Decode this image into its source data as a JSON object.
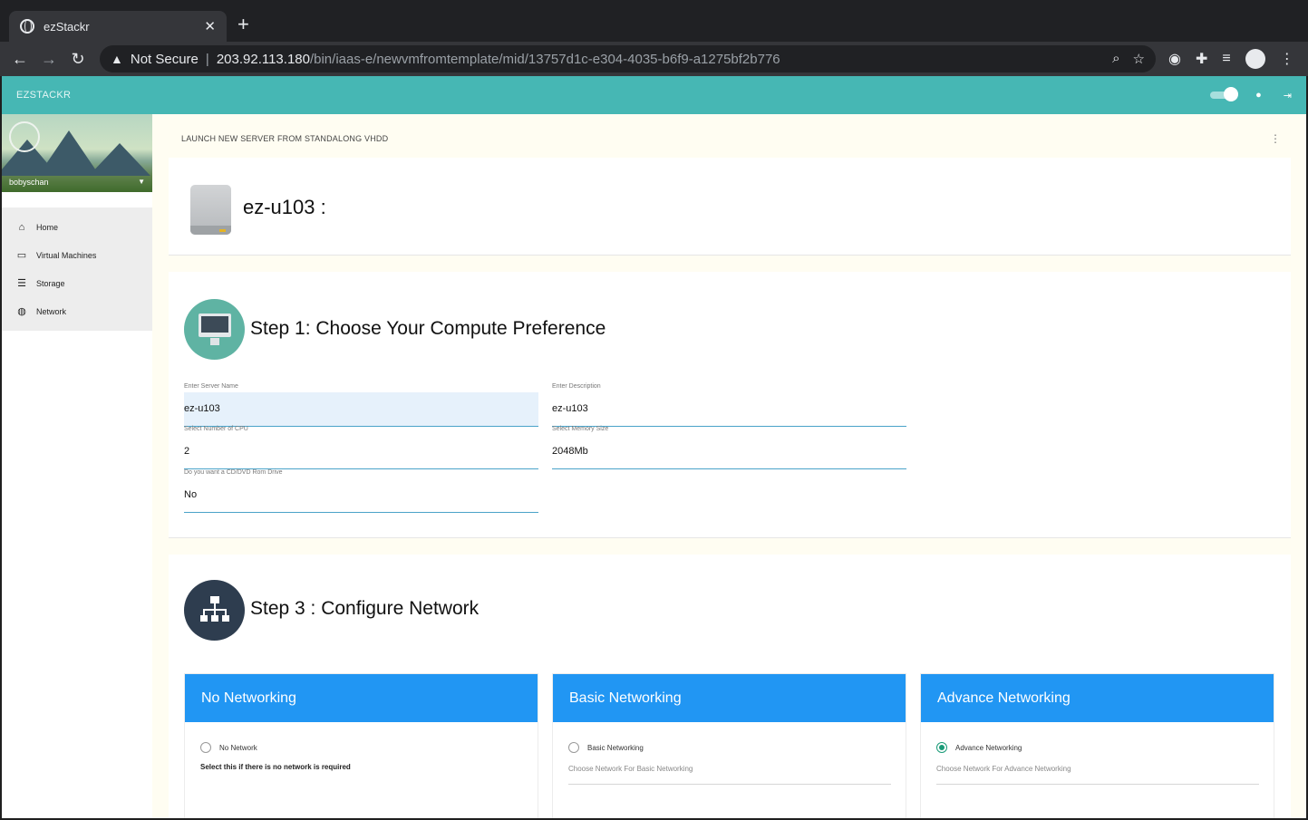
{
  "browser": {
    "tab_title": "ezStackr",
    "tab_close": "✕",
    "new_tab": "+",
    "security_label": "Not Secure",
    "url_host": "203.92.113.180",
    "url_path": "/bin/iaas-e/newvmfromtemplate/mid/13757d1c-e304-4035-b6f9-a1275bf2b776"
  },
  "app": {
    "brand": "EZSTACKR",
    "username": "bobyschan",
    "page_title": "LAUNCH NEW SERVER FROM STANDALONG VHDD",
    "vm_title": "ez-u103 :"
  },
  "sidebar": {
    "items": [
      {
        "label": "Home",
        "icon": "home-icon"
      },
      {
        "label": "Virtual Machines",
        "icon": "devices-icon"
      },
      {
        "label": "Storage",
        "icon": "storage-list-icon"
      },
      {
        "label": "Network",
        "icon": "globe-icon"
      }
    ]
  },
  "step1": {
    "title": "Step 1: Choose Your Compute Preference",
    "server_name_label": "Enter Server Name",
    "server_name_value": "ez-u103",
    "description_label": "Enter Description",
    "description_value": "ez-u103",
    "cpu_label": "Select Number of CPU",
    "cpu_value": "2",
    "memory_label": "Select Memory Size",
    "memory_value": "2048Mb",
    "cdrom_label": "Do you want a CD/DVD Rom Drive",
    "cdrom_value": "No"
  },
  "step3": {
    "title": "Step 3 : Configure Network",
    "options": [
      {
        "header": "No Networking",
        "radio_label": "No Network",
        "hint": "Select this if there is no network is required",
        "selected": false
      },
      {
        "header": "Basic Networking",
        "radio_label": "Basic Networking",
        "select_placeholder": "Choose Network For Basic Networking",
        "selected": false
      },
      {
        "header": "Advance Networking",
        "radio_label": "Advance Networking",
        "select_placeholder": "Choose Network For Advance Networking",
        "selected": true
      }
    ]
  },
  "colors": {
    "appbar": "#46b7b4",
    "card_header": "#2196f3",
    "radio_selected": "#1a9b78",
    "page_bg": "#fffdf2"
  }
}
